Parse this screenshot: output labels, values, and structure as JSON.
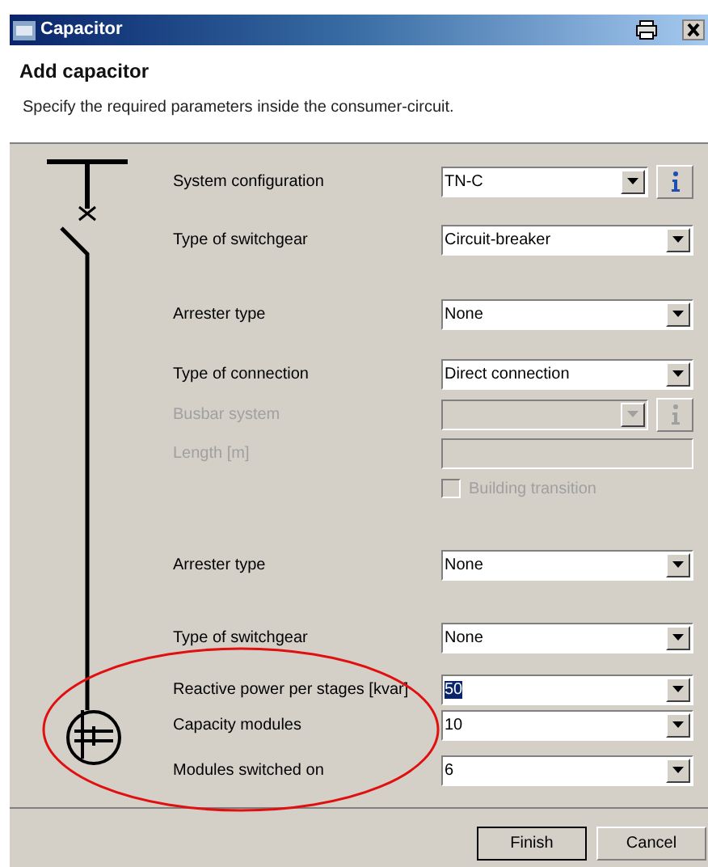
{
  "window": {
    "title": "Capacitor"
  },
  "header": {
    "title": "Add capacitor",
    "subtitle": "Specify the required parameters inside the consumer-circuit."
  },
  "fields": [
    {
      "kind": "select",
      "label": "System configuration",
      "value": "TN-C",
      "disabled": false,
      "value_highlighted": false,
      "info": {
        "disabled": false
      }
    },
    {
      "kind": "select",
      "label": "Type of switchgear",
      "value": "Circuit-breaker",
      "disabled": false,
      "value_highlighted": false
    },
    {
      "kind": "select",
      "label": "Arrester type",
      "value": "None",
      "disabled": false,
      "value_highlighted": false
    },
    {
      "kind": "select",
      "label": "Type of connection",
      "value": "Direct connection",
      "disabled": false,
      "value_highlighted": false
    },
    {
      "kind": "select",
      "label": "Busbar system",
      "disabled": true,
      "info": {
        "disabled": true
      }
    },
    {
      "kind": "text",
      "label": "Length [m]",
      "disabled": true
    },
    {
      "kind": "checkbox",
      "label": "Building transition",
      "checked": false,
      "disabled": true
    },
    {
      "kind": "select",
      "label": "Arrester type",
      "value": "None",
      "disabled": false,
      "value_highlighted": false
    },
    {
      "kind": "select",
      "label": "Type of switchgear",
      "value": "None",
      "disabled": false,
      "value_highlighted": false
    },
    {
      "kind": "select",
      "label": "Reactive power per stages [kvar]",
      "value": "50",
      "disabled": false,
      "value_highlighted": true
    },
    {
      "kind": "select",
      "label": "Capacity modules",
      "value": "10",
      "disabled": false,
      "value_highlighted": false
    },
    {
      "kind": "select",
      "label": "Modules switched on",
      "value": "6",
      "disabled": false,
      "value_highlighted": false
    }
  ],
  "buttons": [
    {
      "label": "Finish",
      "default": true
    },
    {
      "label": "Cancel",
      "default": false
    }
  ]
}
